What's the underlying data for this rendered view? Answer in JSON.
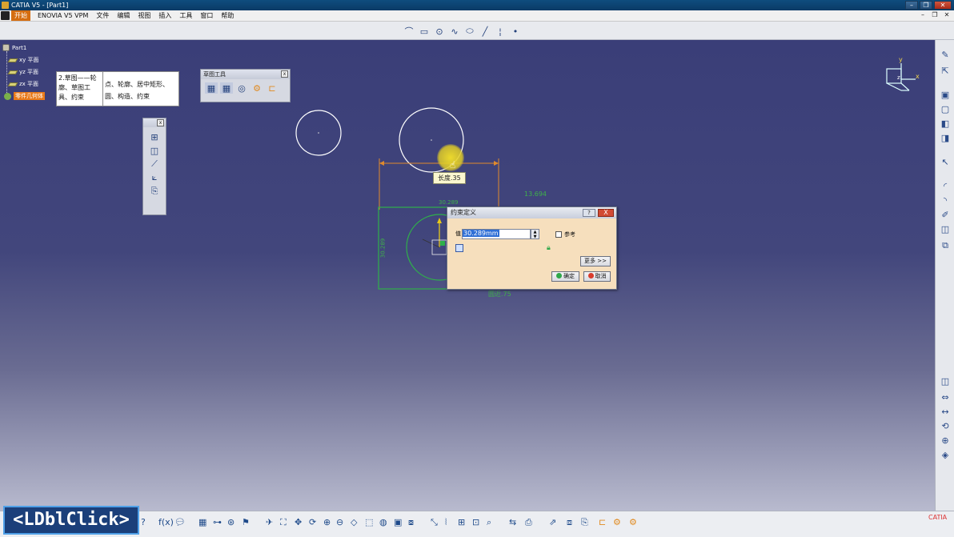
{
  "window": {
    "title": "CATIA V5 - [Part1]"
  },
  "menu": {
    "start": "开始",
    "items": [
      "ENOVIA V5 VPM",
      "文件",
      "编辑",
      "视图",
      "插入",
      "工具",
      "窗口",
      "帮助"
    ]
  },
  "tree": {
    "root": "Part1",
    "nodes": [
      "xy 平面",
      "yz 平面",
      "zx 平面",
      "零件几何体"
    ]
  },
  "note": {
    "left": "2.草图——轮廓、草图工具、约束",
    "right": "点、轮廓、居中矩形、圆、构造、约束"
  },
  "sketch_tools": {
    "title": "草图工具"
  },
  "compass": {
    "x": "x",
    "y": "y",
    "z": "z"
  },
  "canvas_labels": {
    "tooltip": "长度.35",
    "dim_right": "13.694",
    "dim_top": "30.289",
    "dim_bottom": "圆近.75",
    "dim_left": "30.289"
  },
  "dialog": {
    "title": "约束定义",
    "help": "?",
    "close": "X",
    "field_label": "值",
    "value": "30.289mm",
    "reference_label": "参考",
    "more": "更多 >>",
    "ok": "确定",
    "cancel": "取消"
  },
  "overlay": {
    "label": "<LDblClick>"
  },
  "colors": {
    "title_bar": "#0f4d7e",
    "canvas_top": "#3a3e78",
    "canvas_bottom": "#b8bace",
    "constraint_green": "#3fb14a",
    "dialog_bg": "#f6dfbd",
    "highlight_orange": "#e87a1a"
  }
}
